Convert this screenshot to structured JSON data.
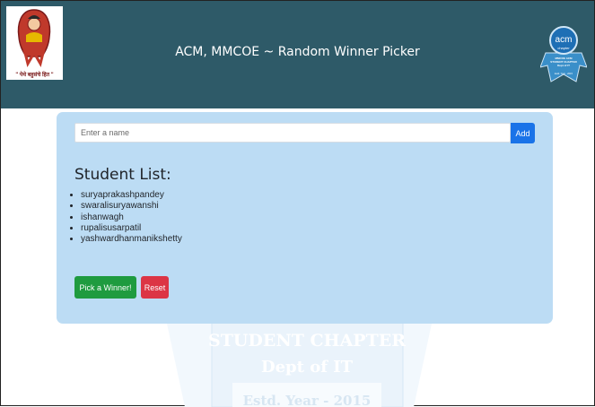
{
  "header": {
    "title": "ACM, MMCOE ~ Random Winner Picker",
    "left_logo": {
      "motto": "\" पेथे बहुसंचे हित \""
    },
    "right_logo": {
      "text": "acm",
      "lines": [
        "chapter",
        "MMCOE ACM",
        "STUDENT CHAPTER",
        "Dept of IT",
        "Estd. Year - 2015"
      ]
    }
  },
  "watermark": {
    "line1": "STUDENT CHAPTER",
    "line2": "Dept of IT",
    "line3": "Estd. Year - 2015"
  },
  "form": {
    "placeholder": "Enter a name",
    "add_label": "Add"
  },
  "student_list": {
    "title": "Student List:",
    "items": [
      "suryaprakashpandey",
      "swaralisuryawanshi",
      "ishanwagh",
      "rupalisusarpatil",
      "yashwardhanmanikshetty"
    ]
  },
  "buttons": {
    "pick_label": "Pick a Winner!",
    "reset_label": "Reset"
  },
  "colors": {
    "header_bg": "#2e5a68",
    "card_bg": "#bcdcf4",
    "add_btn": "#1a73e8",
    "pick_btn": "#1f9b3f",
    "reset_btn": "#dc3545"
  }
}
